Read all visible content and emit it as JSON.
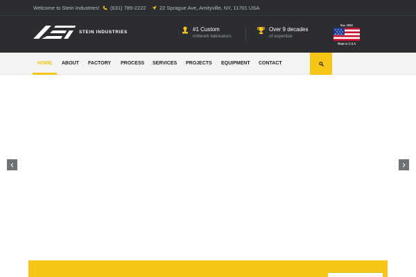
{
  "topbar": {
    "welcome": "Welcome to Stein Industries!",
    "phone": "(631) 789-2222",
    "address": "22 Sprague Ave, Amityville, NY, 11701 USA"
  },
  "header": {
    "logo_text": "STEIN INDUSTRIES",
    "features": [
      {
        "title": "#1 Custom",
        "subtitle": "millwork fabricators"
      },
      {
        "title": "Over 9 decades",
        "subtitle": "of expertise"
      }
    ],
    "badge": {
      "top": "Est. 1932",
      "bottom": "Made in U.S.A"
    }
  },
  "nav": {
    "items": [
      {
        "label": "Home"
      },
      {
        "label": "About"
      },
      {
        "label": "Factory"
      },
      {
        "label": "Process"
      },
      {
        "label": "Services"
      },
      {
        "label": "Projects"
      },
      {
        "label": "Equipment"
      },
      {
        "label": "Contact"
      }
    ]
  },
  "colors": {
    "accent": "#f5c518",
    "dark": "#2b2d30",
    "nav_bg": "#f3f3f3"
  },
  "icons": {
    "phone": "phone-icon",
    "location": "location-arrow-icon",
    "stamp": "stamp-icon",
    "trophy": "trophy-icon",
    "search": "search-icon",
    "prev": "chevron-left-icon",
    "next": "chevron-right-icon"
  }
}
